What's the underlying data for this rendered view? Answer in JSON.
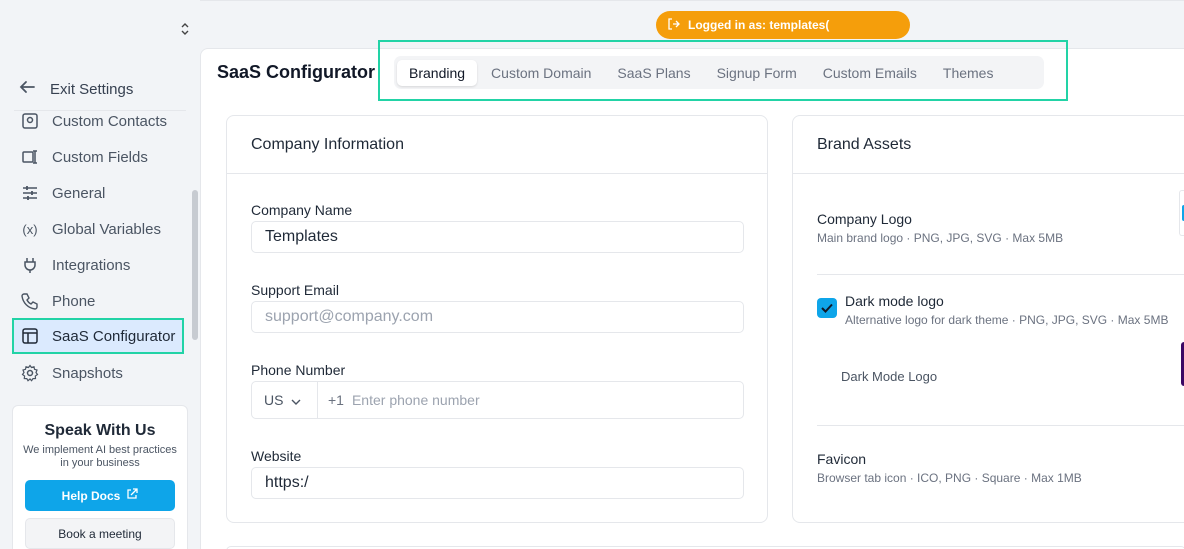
{
  "sidebar": {
    "exit_label": "Exit Settings",
    "items": [
      {
        "label": "Custom Contacts",
        "icon": "contacts-icon"
      },
      {
        "label": "Custom Fields",
        "icon": "custom-fields-icon"
      },
      {
        "label": "General",
        "icon": "sliders-icon"
      },
      {
        "label": "Global Variables",
        "icon": "variable-icon"
      },
      {
        "label": "Integrations",
        "icon": "plug-icon"
      },
      {
        "label": "Phone",
        "icon": "phone-icon"
      },
      {
        "label": "SaaS Configurator",
        "icon": "layout-icon",
        "active": true
      },
      {
        "label": "Snapshots",
        "icon": "gear-icon"
      }
    ],
    "help": {
      "title": "Speak With Us",
      "subtitle": "We implement AI best practices in your business",
      "help_docs_label": "Help Docs",
      "book_label": "Book a meeting"
    }
  },
  "topbar": {
    "logged_in_text": "Logged in as: templates("
  },
  "page": {
    "title": "SaaS Configurator",
    "tabs": [
      "Branding",
      "Custom Domain",
      "SaaS Plans",
      "Signup Form",
      "Custom Emails",
      "Themes"
    ],
    "active_tab": "Branding"
  },
  "company_info": {
    "title": "Company Information",
    "company_name_label": "Company Name",
    "company_name_value": "Templates",
    "support_email_label": "Support Email",
    "support_email_placeholder": "support@company.com",
    "phone_label": "Phone Number",
    "phone_country": "US",
    "phone_dial": "+1",
    "phone_placeholder": "Enter phone number",
    "website_label": "Website",
    "website_value": "https:/"
  },
  "brand_assets": {
    "title": "Brand Assets",
    "company_logo_title": "Company Logo",
    "company_logo_sub": "Main brand logo · PNG, JPG, SVG · Max 5MB",
    "dark_mode_title": "Dark mode logo",
    "dark_mode_sub": "Alternative logo for dark theme · PNG, JPG, SVG · Max 5MB",
    "dark_mode_checked": true,
    "dark_mode_logo_label": "Dark Mode Logo",
    "favicon_title": "Favicon",
    "favicon_sub": "Browser tab icon · ICO, PNG · Square · Max 1MB"
  },
  "colors": {
    "accent": "#0ea5e9",
    "highlight": "#22d3a6",
    "warning_pill": "#f59e0b"
  }
}
